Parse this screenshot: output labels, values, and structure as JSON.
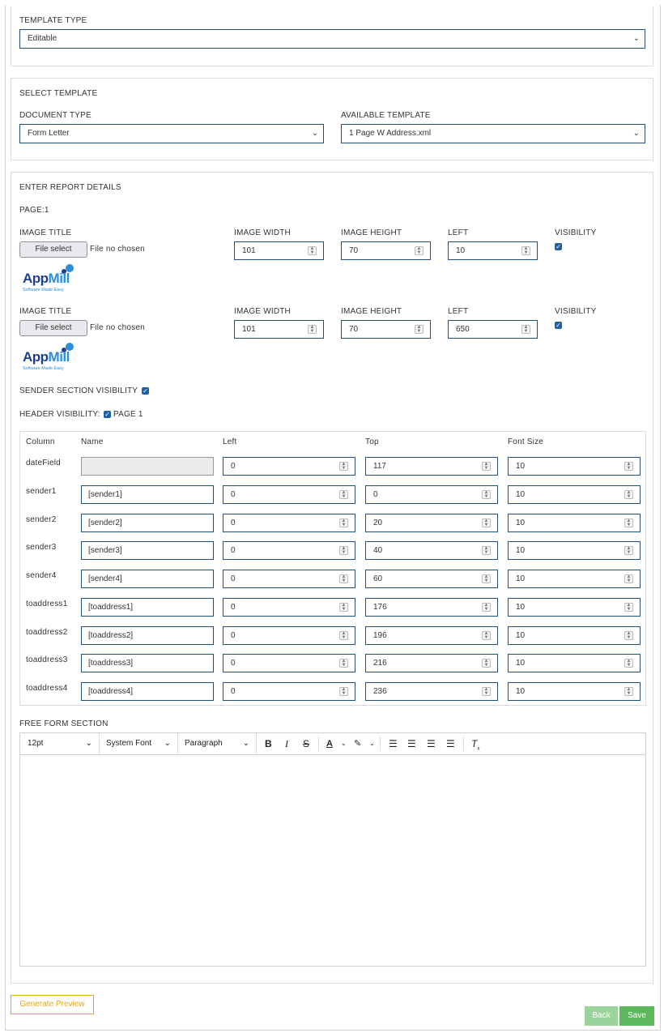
{
  "template_type": {
    "label": "TEMPLATE TYPE",
    "value": "Editable"
  },
  "select_template": {
    "heading": "SELECT TEMPLATE",
    "document_type_label": "DOCUMENT TYPE",
    "document_type_value": "Form Letter",
    "available_template_label": "AVAILABLE TEMPLATE",
    "available_template_value": "1 Page W Address.xml"
  },
  "report": {
    "heading": "ENTER REPORT DETAILS",
    "page_label": "PAGE:1",
    "images": [
      {
        "title_label": "IMAGE TITLE",
        "file_button": "File select",
        "file_status": "File no chosen",
        "width_label": "IMAGE WIDTH",
        "width": "101",
        "height_label": "IMAGE HEIGHT",
        "height": "70",
        "left_label": "LEFT",
        "left": "10",
        "visibility_label": "VISIBILITY",
        "logo_text_a": "App",
        "logo_text_b": "Mill",
        "logo_tagline": "Software Made Easy"
      },
      {
        "title_label": "IMAGE TITLE",
        "file_button": "File select",
        "file_status": "File no chosen",
        "width_label": "IMAGE WIDTH",
        "width": "101",
        "height_label": "IMAGE HEIGHT",
        "height": "70",
        "left_label": "LEFT",
        "left": "650",
        "visibility_label": "VISIBILITY",
        "logo_text_a": "App",
        "logo_text_b": "Mill",
        "logo_tagline": "Software Made Easy"
      }
    ],
    "sender_visibility_label": "SENDER SECTION VISIBILITY",
    "header_visibility_label": "HEADER VISIBILITY:",
    "header_page_label": "PAGE 1"
  },
  "fields_table": {
    "headers": [
      "Column",
      "Name",
      "Left",
      "Top",
      "Font Size"
    ],
    "rows": [
      {
        "column": "dateField",
        "name": "",
        "left": "0",
        "top": "117",
        "font_size": "10"
      },
      {
        "column": "sender1",
        "name": "[sender1]",
        "left": "0",
        "top": "0",
        "font_size": "10"
      },
      {
        "column": "sender2",
        "name": "[sender2]",
        "left": "0",
        "top": "20",
        "font_size": "10"
      },
      {
        "column": "sender3",
        "name": "[sender3]",
        "left": "0",
        "top": "40",
        "font_size": "10"
      },
      {
        "column": "sender4",
        "name": "[sender4]",
        "left": "0",
        "top": "60",
        "font_size": "10"
      },
      {
        "column": "toaddress1",
        "name": "[toaddress1]",
        "left": "0",
        "top": "176",
        "font_size": "10"
      },
      {
        "column": "toaddress2",
        "name": "[toaddress2]",
        "left": "0",
        "top": "196",
        "font_size": "10"
      },
      {
        "column": "toaddress3",
        "name": "[toaddress3]",
        "left": "0",
        "top": "216",
        "font_size": "10"
      },
      {
        "column": "toaddress4",
        "name": "[toaddress4]",
        "left": "0",
        "top": "236",
        "font_size": "10"
      }
    ]
  },
  "free_form": {
    "label": "FREE FORM SECTION",
    "font_size": "12pt",
    "font_family": "System Font",
    "block_format": "Paragraph",
    "content": ""
  },
  "buttons": {
    "generate_preview": "Generate Preview",
    "back": "Back",
    "save": "Save"
  },
  "colors": {
    "input_border": "#1f4e79",
    "preview_border": "#e6a817",
    "save_green": "#5cb85c",
    "back_green": "#9bd49b"
  }
}
